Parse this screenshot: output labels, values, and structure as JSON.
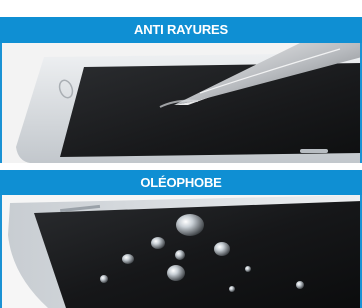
{
  "colors": {
    "banner": "#0f8fd3",
    "banner_text": "#ffffff",
    "screen_dark": "#1c1d1f",
    "phone_frame": "#d9dde2"
  },
  "sections": [
    {
      "label": "ANTI RAYURES",
      "image": "phone-screen-scratch-test-with-knife"
    },
    {
      "label": "OLÉOPHOBE",
      "image": "phone-screen-with-water-droplets"
    }
  ]
}
